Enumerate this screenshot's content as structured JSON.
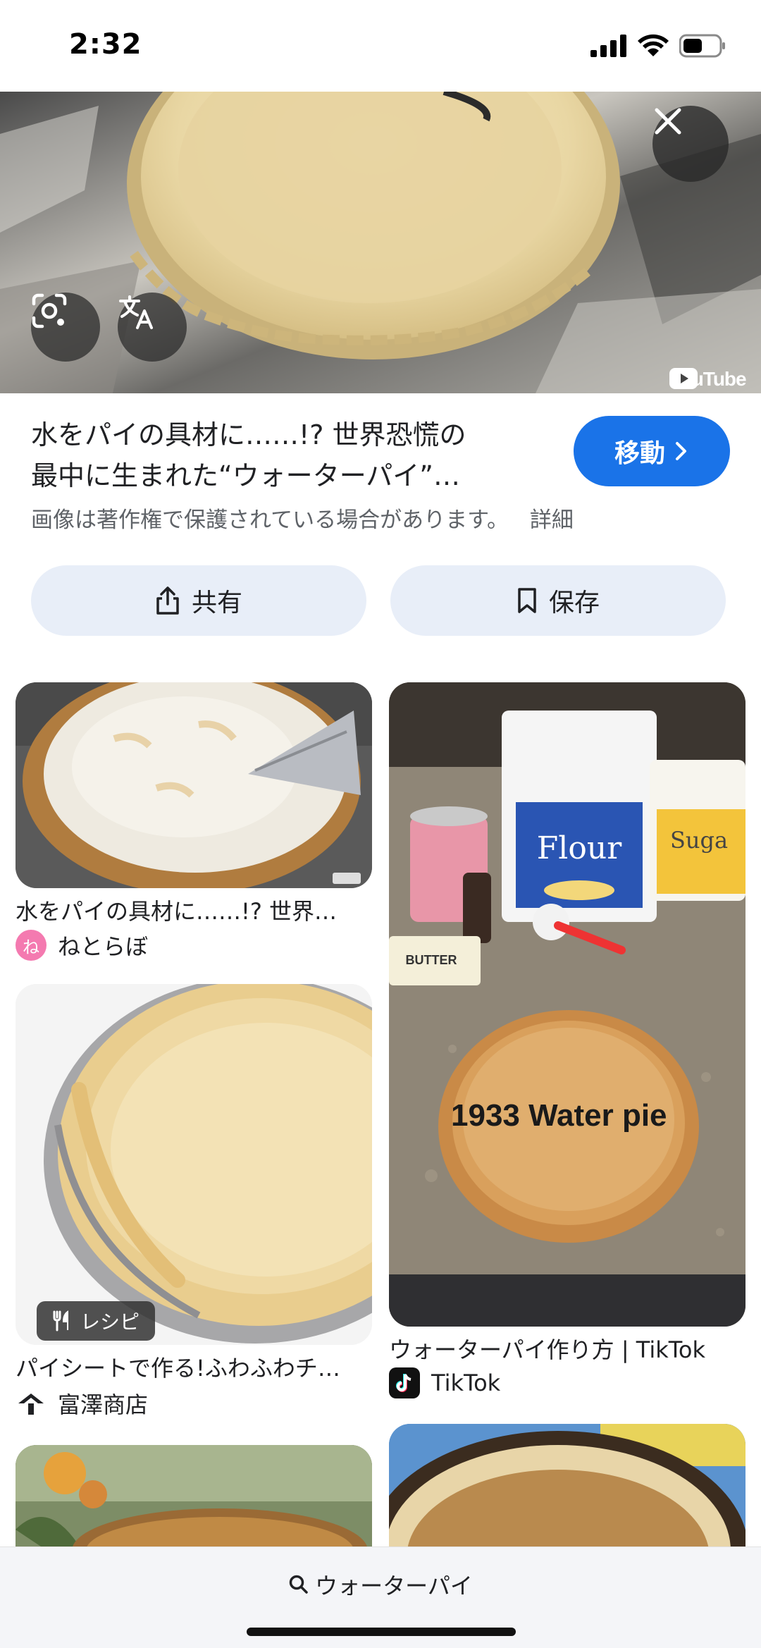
{
  "status_bar": {
    "time": "2:32"
  },
  "hero": {
    "watermark": "YouTube"
  },
  "result": {
    "title_line1": "水をパイの具材に……!? 世界恐慌の",
    "title_line2": "最中に生まれた“ウォーターパイ”…",
    "go_label": "移動",
    "copyright": "画像は著作権で保護されている場合があります。",
    "details_label": "詳細"
  },
  "actions": {
    "share_label": "共有",
    "save_label": "保存"
  },
  "grid": {
    "card1": {
      "caption": "水をパイの具材に……!? 世界…",
      "source": "ねとらぼ",
      "source_initial": "ね"
    },
    "card2": {
      "caption": "ウォーターパイ作り方 | TikTok",
      "source": "TikTok",
      "overlay_text": "1933 Water pie",
      "brand_flour": "Flour",
      "brand_sugar": "Suga",
      "butter_label": "BUTTER"
    },
    "card3": {
      "caption": "パイシートで作る!ふわふわチ…",
      "source": "富澤商店",
      "badge": "レシピ"
    }
  },
  "bottom_bar": {
    "query": "ウォーターパイ"
  },
  "colors": {
    "accent": "#1a73e8",
    "action_bg": "#e8eef8"
  }
}
